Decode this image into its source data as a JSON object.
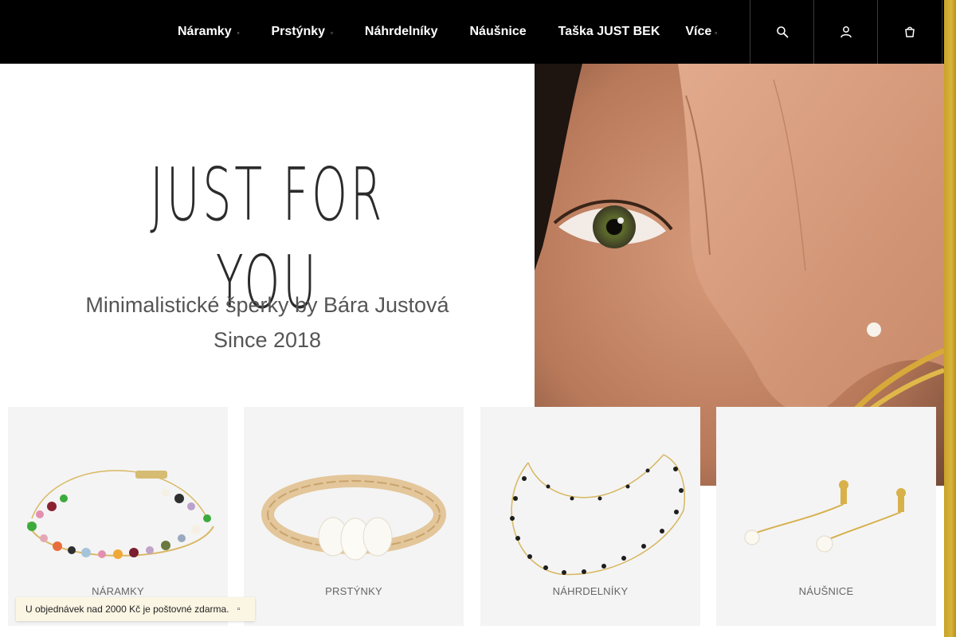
{
  "header": {
    "nav": [
      {
        "label": "Náramky",
        "caret": "▫"
      },
      {
        "label": "Prstýnky",
        "caret": "▫"
      },
      {
        "label": "Náhrdelníky"
      },
      {
        "label": "Náušnice"
      },
      {
        "label": "Taška JUST BEK"
      },
      {
        "label": "Více",
        "caret": "▫"
      }
    ],
    "icons": [
      "search-icon",
      "user-icon",
      "cart-icon"
    ]
  },
  "hero": {
    "title": "JUST FOR YOU",
    "subtitle_line1": "Minimalistické šperky by Bára Justová",
    "subtitle_line2": "Since 2018"
  },
  "categories": [
    {
      "label": "NÁRAMKY"
    },
    {
      "label": "PRSTÝNKY"
    },
    {
      "label": "NÁHRDELNÍKY"
    },
    {
      "label": "NÁUŠNICE"
    }
  ],
  "notice": {
    "text": "U objednávek nad 2000 Kč je poštovné zdarma.",
    "close": "▫"
  },
  "colors": {
    "header_bg": "#000000",
    "accent_gold": "#c9a227",
    "text_dark": "#2b2b2b"
  }
}
